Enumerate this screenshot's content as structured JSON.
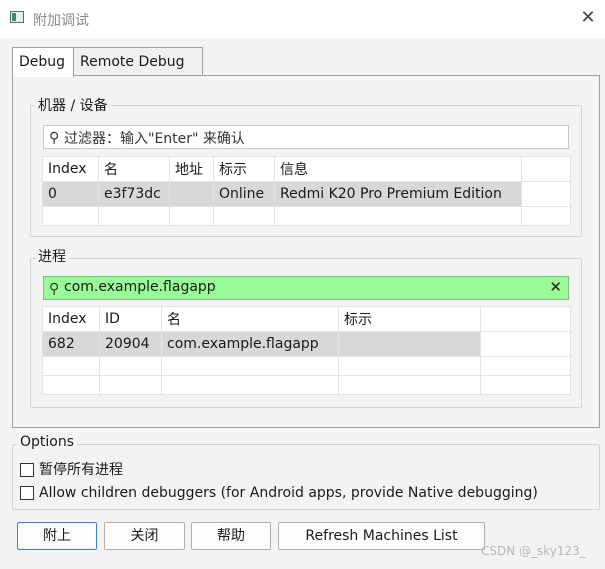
{
  "window": {
    "title": "附加调试",
    "close_glyph": "✕"
  },
  "tabs": [
    {
      "label": "Debug"
    },
    {
      "label": "Remote Debug"
    }
  ],
  "machines": {
    "group_title": "机器 / 设备",
    "filter_placeholder": "过滤器：输入\"Enter\" 来确认",
    "columns": [
      "Index",
      "名",
      "地址",
      "标示",
      "信息"
    ],
    "rows": [
      {
        "index": "0",
        "name": "e3f73dc",
        "address": "",
        "tag": "Online",
        "info": "Redmi K20 Pro Premium Edition"
      }
    ]
  },
  "processes": {
    "group_title": "进程",
    "filter_value": "com.example.flagapp",
    "clear_glyph": "✕",
    "columns": [
      "Index",
      "ID",
      "名",
      "标示"
    ],
    "rows": [
      {
        "index": "682",
        "id": "20904",
        "name": "com.example.flagapp",
        "tag": ""
      }
    ]
  },
  "options": {
    "title": "Options",
    "pause_all": "暂停所有进程",
    "allow_children": "Allow children debuggers (for Android apps, provide Native debugging)"
  },
  "buttons": {
    "attach": "附上",
    "close": "关闭",
    "help": "帮助",
    "refresh": "Refresh Machines List"
  },
  "watermark": "CSDN @_sky123_",
  "icons": {
    "search": "search-icon",
    "close": "close-icon",
    "clear": "clear-icon",
    "app": "app-icon"
  }
}
